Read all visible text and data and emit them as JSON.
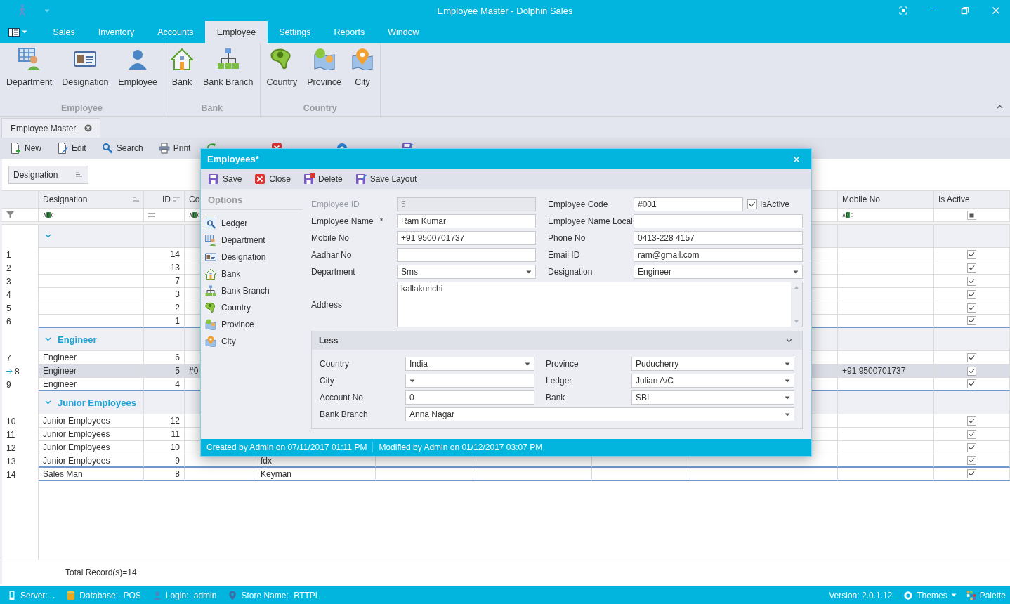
{
  "window": {
    "title": "Employee Master - Dolphin Sales"
  },
  "menu_tabs": [
    {
      "label": "Sales",
      "selected": false
    },
    {
      "label": "Inventory",
      "selected": false
    },
    {
      "label": "Accounts",
      "selected": false
    },
    {
      "label": "Employee",
      "selected": true
    },
    {
      "label": "Settings",
      "selected": false
    },
    {
      "label": "Reports",
      "selected": false
    },
    {
      "label": "Window",
      "selected": false
    }
  ],
  "ribbon": {
    "groups": [
      {
        "title": "Employee",
        "items": [
          {
            "label": "Department",
            "kind": "department"
          },
          {
            "label": "Designation",
            "kind": "designation"
          },
          {
            "label": "Employee",
            "kind": "employee"
          }
        ]
      },
      {
        "title": "Bank",
        "items": [
          {
            "label": "Bank",
            "kind": "bank"
          },
          {
            "label": "Bank Branch",
            "kind": "bank_branch"
          }
        ]
      },
      {
        "title": "Country",
        "items": [
          {
            "label": "Country",
            "kind": "country"
          },
          {
            "label": "Province",
            "kind": "province"
          },
          {
            "label": "City",
            "kind": "city"
          }
        ]
      }
    ]
  },
  "document_tab": {
    "label": "Employee Master"
  },
  "toolbar": [
    {
      "label": "New",
      "kind": "new"
    },
    {
      "label": "Edit",
      "kind": "edit"
    },
    {
      "label": "Search",
      "kind": "search"
    },
    {
      "label": "Print",
      "kind": "print"
    },
    {
      "kind": "refresh"
    },
    {
      "kind": "close"
    },
    {
      "kind": "help"
    },
    {
      "kind": "save_layout"
    }
  ],
  "group_panel": {
    "chip": "Designation"
  },
  "grid": {
    "columns": [
      {
        "label": "Designation",
        "kind": "text",
        "sorted": true
      },
      {
        "label": "ID",
        "kind": "equals",
        "sorted": true
      },
      {
        "label": "Co",
        "kind": "text",
        "sorted": false
      },
      {
        "label": "Mobile No",
        "kind": "text",
        "sorted": false
      },
      {
        "label": "Is Active",
        "kind": "check",
        "sorted": false
      }
    ],
    "rows": [
      {
        "kind": "group",
        "expanded": true
      },
      {
        "kind": "row",
        "number": "1",
        "id": "14",
        "active": true,
        "selected": false
      },
      {
        "kind": "row",
        "number": "2",
        "id": "13",
        "active": true,
        "selected": false
      },
      {
        "kind": "row",
        "number": "3",
        "id": "7",
        "active": true,
        "selected": false
      },
      {
        "kind": "row",
        "number": "4",
        "id": "3",
        "active": true,
        "selected": false
      },
      {
        "kind": "row",
        "number": "5",
        "id": "2",
        "active": true,
        "selected": false
      },
      {
        "kind": "row",
        "number": "6",
        "id": "1",
        "active": true,
        "selected": false
      },
      {
        "kind": "group",
        "label": "Engineer",
        "expanded": true
      },
      {
        "kind": "row",
        "number": "7",
        "designation": "Engineer",
        "id": "6",
        "active": true,
        "selected": false
      },
      {
        "kind": "row",
        "number": "8",
        "designation": "Engineer",
        "id": "5",
        "code": "#0",
        "mobile": "+91 9500701737",
        "active": true,
        "selected": true
      },
      {
        "kind": "row",
        "number": "9",
        "designation": "Engineer",
        "id": "4",
        "active": true,
        "selected": false
      },
      {
        "kind": "group",
        "label": "Junior Employees",
        "expanded": true
      },
      {
        "kind": "row",
        "number": "10",
        "designation": "Junior Employees",
        "id": "12",
        "active": true,
        "selected": false
      },
      {
        "kind": "row",
        "number": "11",
        "designation": "Junior Employees",
        "id": "11",
        "active": true,
        "selected": false
      },
      {
        "kind": "row",
        "number": "12",
        "designation": "Junior Employees",
        "id": "10",
        "active": true,
        "selected": false
      },
      {
        "kind": "row",
        "number": "13",
        "designation": "Junior Employees",
        "id": "9",
        "column_4": "fdx",
        "active": true,
        "selected": false
      },
      {
        "kind": "row",
        "number": "14",
        "designation": "Sales Man",
        "id": "8",
        "column_4": "Keyman",
        "active": true,
        "selected": false
      }
    ],
    "footer": "Total Record(s)=14"
  },
  "dialog": {
    "title": "Employees*",
    "toolbar": [
      {
        "label": "Save",
        "kind": "save"
      },
      {
        "label": "Close",
        "kind": "close"
      },
      {
        "label": "Delete",
        "kind": "delete"
      },
      {
        "label": "Save Layout",
        "kind": "save_layout"
      }
    ],
    "options": {
      "title": "Options",
      "items": [
        {
          "label": "Ledger",
          "kind": "ledger"
        },
        {
          "label": "Department",
          "kind": "department"
        },
        {
          "label": "Designation",
          "kind": "designation"
        },
        {
          "label": "Bank",
          "kind": "bank"
        },
        {
          "label": "Bank Branch",
          "kind": "bank_branch"
        },
        {
          "label": "Country",
          "kind": "country"
        },
        {
          "label": "Province",
          "kind": "province"
        },
        {
          "label": "City",
          "kind": "city"
        }
      ]
    },
    "form": [
      {
        "label": "Employee ID",
        "kind": "readonly",
        "value": "5"
      },
      {
        "label": "Employee Code",
        "kind": "text",
        "value": "#001",
        "checkbox": {
          "label": "IsActive",
          "checked": true
        }
      },
      {
        "label": "Employee Name",
        "kind": "text",
        "value": "Ram Kumar",
        "marker": "*"
      },
      {
        "label": "Employee Name Local",
        "kind": "text"
      },
      {
        "label": "Mobile No",
        "kind": "text",
        "value": "+91 9500701737"
      },
      {
        "label": "Phone No",
        "kind": "text",
        "value": "0413-228 4157"
      },
      {
        "label": "Aadhar No",
        "kind": "text"
      },
      {
        "label": "Email ID",
        "kind": "text",
        "value": "ram@gmail.com"
      },
      {
        "label": "Department",
        "kind": "combo",
        "value": "Sms"
      },
      {
        "label": "Designation",
        "kind": "combo",
        "value": "Engineer"
      },
      {
        "label": "Address",
        "kind": "memo",
        "value": "kallakurichi"
      }
    ],
    "less_group": {
      "title": "Less",
      "expanded": true,
      "fields": [
        {
          "label": "Country",
          "kind": "combo",
          "value": "India"
        },
        {
          "label": "Province",
          "kind": "combo",
          "value": "Puducherry"
        },
        {
          "label": "City",
          "kind": "combo"
        },
        {
          "label": "Ledger",
          "kind": "combo",
          "value": "Julian A/C"
        },
        {
          "label": "Account No",
          "kind": "text",
          "value": "0"
        },
        {
          "label": "Bank",
          "kind": "combo",
          "value": "SBI"
        },
        {
          "label": "Bank Branch",
          "kind": "combo",
          "value": "Anna Nagar",
          "wide": true
        }
      ]
    },
    "footer": [
      "Created by Admin on 07/11/2017 01:11 PM",
      "Modified by Admin on 01/12/2017 03:07 PM"
    ]
  },
  "status_bar": {
    "left": [
      {
        "label": "Server:- .",
        "kind": "server"
      },
      {
        "label": "Database:- POS",
        "kind": "database"
      },
      {
        "label": "Login:- admin",
        "kind": "login"
      },
      {
        "label": "Store Name:- BTTPL",
        "kind": "store"
      }
    ],
    "right": [
      {
        "label": "Version: 2.0.1.12",
        "kind": "version"
      },
      {
        "label": "Themes",
        "kind": "themes"
      },
      {
        "label": "Palette",
        "kind": "palette"
      }
    ]
  }
}
